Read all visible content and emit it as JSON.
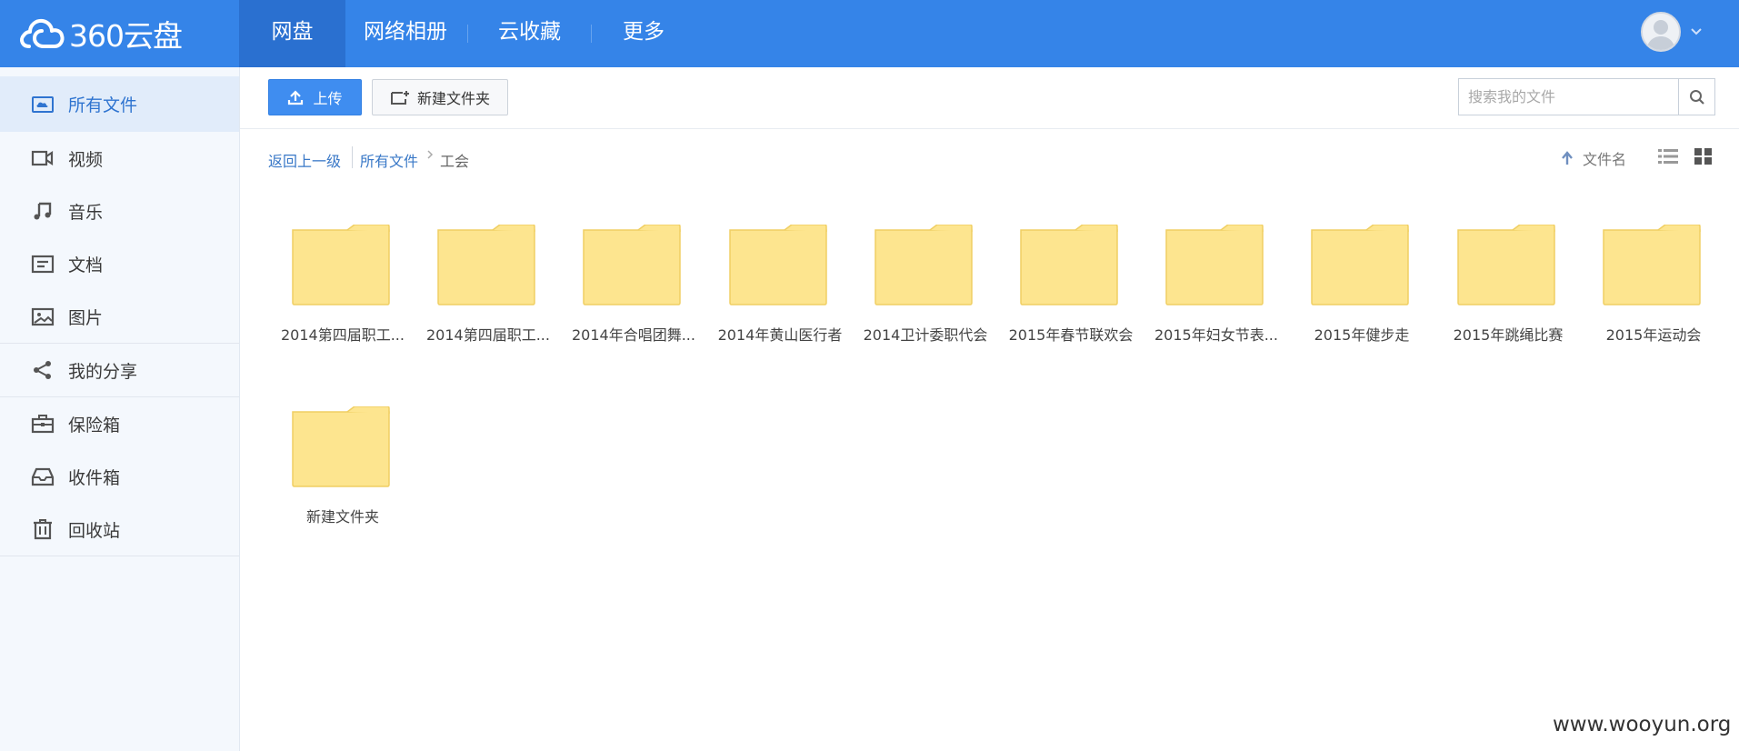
{
  "app": {
    "logo_text": "360云盘"
  },
  "nav": {
    "items": [
      {
        "label": "网盘",
        "active": true
      },
      {
        "label": "网络相册"
      },
      {
        "label": "云收藏"
      },
      {
        "label": "更多"
      }
    ]
  },
  "sidebar": {
    "items": [
      {
        "label": "所有文件",
        "icon": "cloud-drive-icon",
        "active": true
      },
      {
        "label": "视频",
        "icon": "video-icon"
      },
      {
        "label": "音乐",
        "icon": "music-icon"
      },
      {
        "label": "文档",
        "icon": "document-icon"
      },
      {
        "label": "图片",
        "icon": "image-icon"
      },
      {
        "label": "我的分享",
        "icon": "share-icon"
      },
      {
        "label": "保险箱",
        "icon": "safe-icon"
      },
      {
        "label": "收件箱",
        "icon": "inbox-icon"
      },
      {
        "label": "回收站",
        "icon": "trash-icon"
      }
    ]
  },
  "toolbar": {
    "upload_label": "上传",
    "new_folder_label": "新建文件夹",
    "search_placeholder": "搜索我的文件"
  },
  "breadcrumb": {
    "back_label": "返回上一级",
    "root_label": "所有文件",
    "current_label": "工会"
  },
  "sort": {
    "label": "文件名"
  },
  "folders": [
    "2014第四届职工...",
    "2014第四届职工...",
    "2014年合唱团舞...",
    "2014年黄山医行者",
    "2014卫计委职代会",
    "2015年春节联欢会",
    "2015年妇女节表...",
    "2015年健步走",
    "2015年跳绳比赛",
    "2015年运动会",
    "新建文件夹"
  ],
  "colors": {
    "topbar": "#3584e8",
    "nav_active": "#2a70d0",
    "sidebar_bg": "#f4f8fd",
    "link": "#3978c7",
    "folder_fill": "#fde58f",
    "folder_stroke": "#f0cf63"
  },
  "watermark": "www.wooyun.org"
}
